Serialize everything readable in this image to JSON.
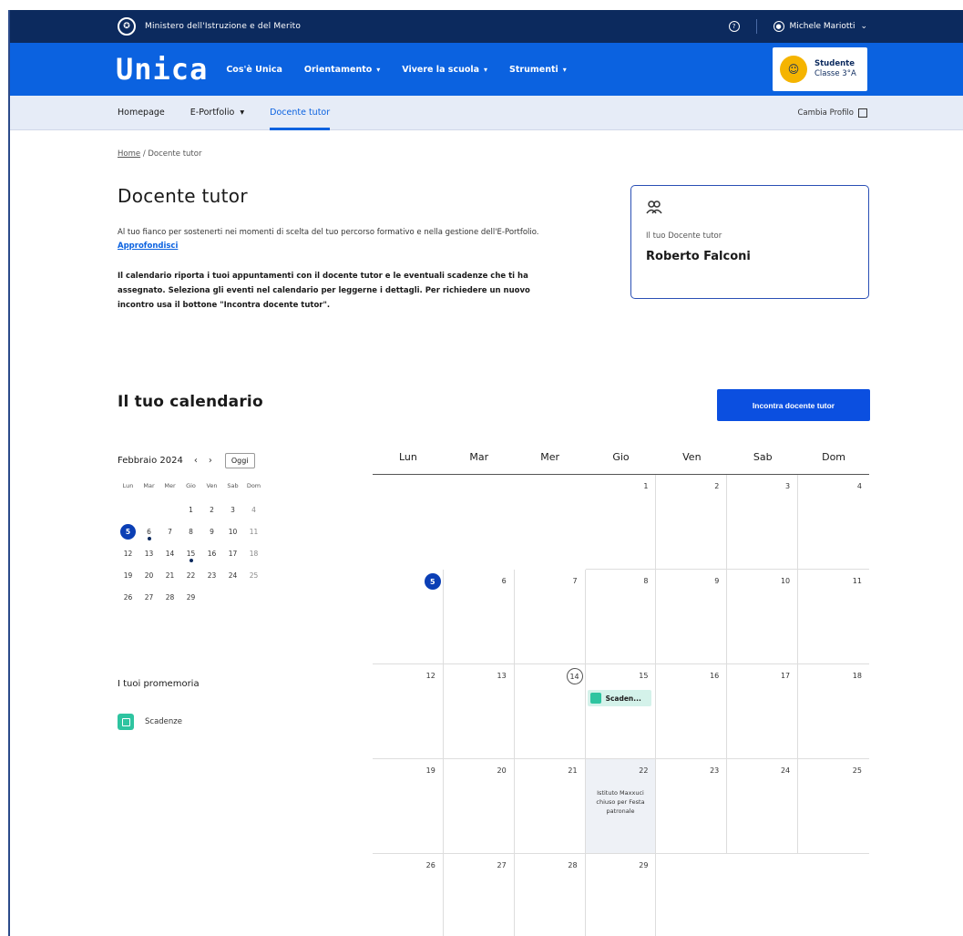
{
  "topbar": {
    "ministry": "Ministero dell'Istruzione e del Merito",
    "user": "Michele Mariotti"
  },
  "nav": {
    "logo": "Unica",
    "items": [
      "Cos'è Unica",
      "Orientamento",
      "Vivere la scuola",
      "Strumenti"
    ]
  },
  "profile": {
    "role": "Studente",
    "class": "Classe 3°A"
  },
  "subnav": {
    "items": [
      "Homepage",
      "E-Portfolio",
      "Docente tutor"
    ],
    "change_profile": "Cambia Profilo"
  },
  "breadcrumb": {
    "home": "Home",
    "current": "Docente tutor"
  },
  "page": {
    "title": "Docente tutor",
    "intro": "Al tuo fianco per sostenerti nei momenti di scelta del tuo percorso formativo e nella gestione dell'E-Portfolio.",
    "intro_link": "Approfondisci",
    "intro_bold": "Il calendario riporta i tuoi appuntamenti con il docente tutor e le eventuali scadenze che ti ha assegnato. Seleziona gli eventi nel calendario per leggerne i dettagli. Per richiedere un nuovo incontro usa il bottone \"Incontra docente tutor\"."
  },
  "tutor": {
    "label": "Il tuo Docente tutor",
    "name": "Roberto Falconi"
  },
  "calendar": {
    "title": "Il tuo calendario",
    "cta": "Incontra docente tutor",
    "month": "Febbraio 2024",
    "today_label": "Oggi",
    "weekdays_short": [
      "Lun",
      "Mar",
      "Mer",
      "Gio",
      "Ven",
      "Sab",
      "Dom"
    ],
    "weekdays": [
      "Lun",
      "Mar",
      "Mer",
      "Gio",
      "Ven",
      "Sab",
      "Dom"
    ],
    "event_label": "Scaden...",
    "note_text": "Istituto Maxxuci chiuso per Festa patronale"
  },
  "reminders": {
    "title": "I tuoi promemoria",
    "item": "Scadenze"
  }
}
